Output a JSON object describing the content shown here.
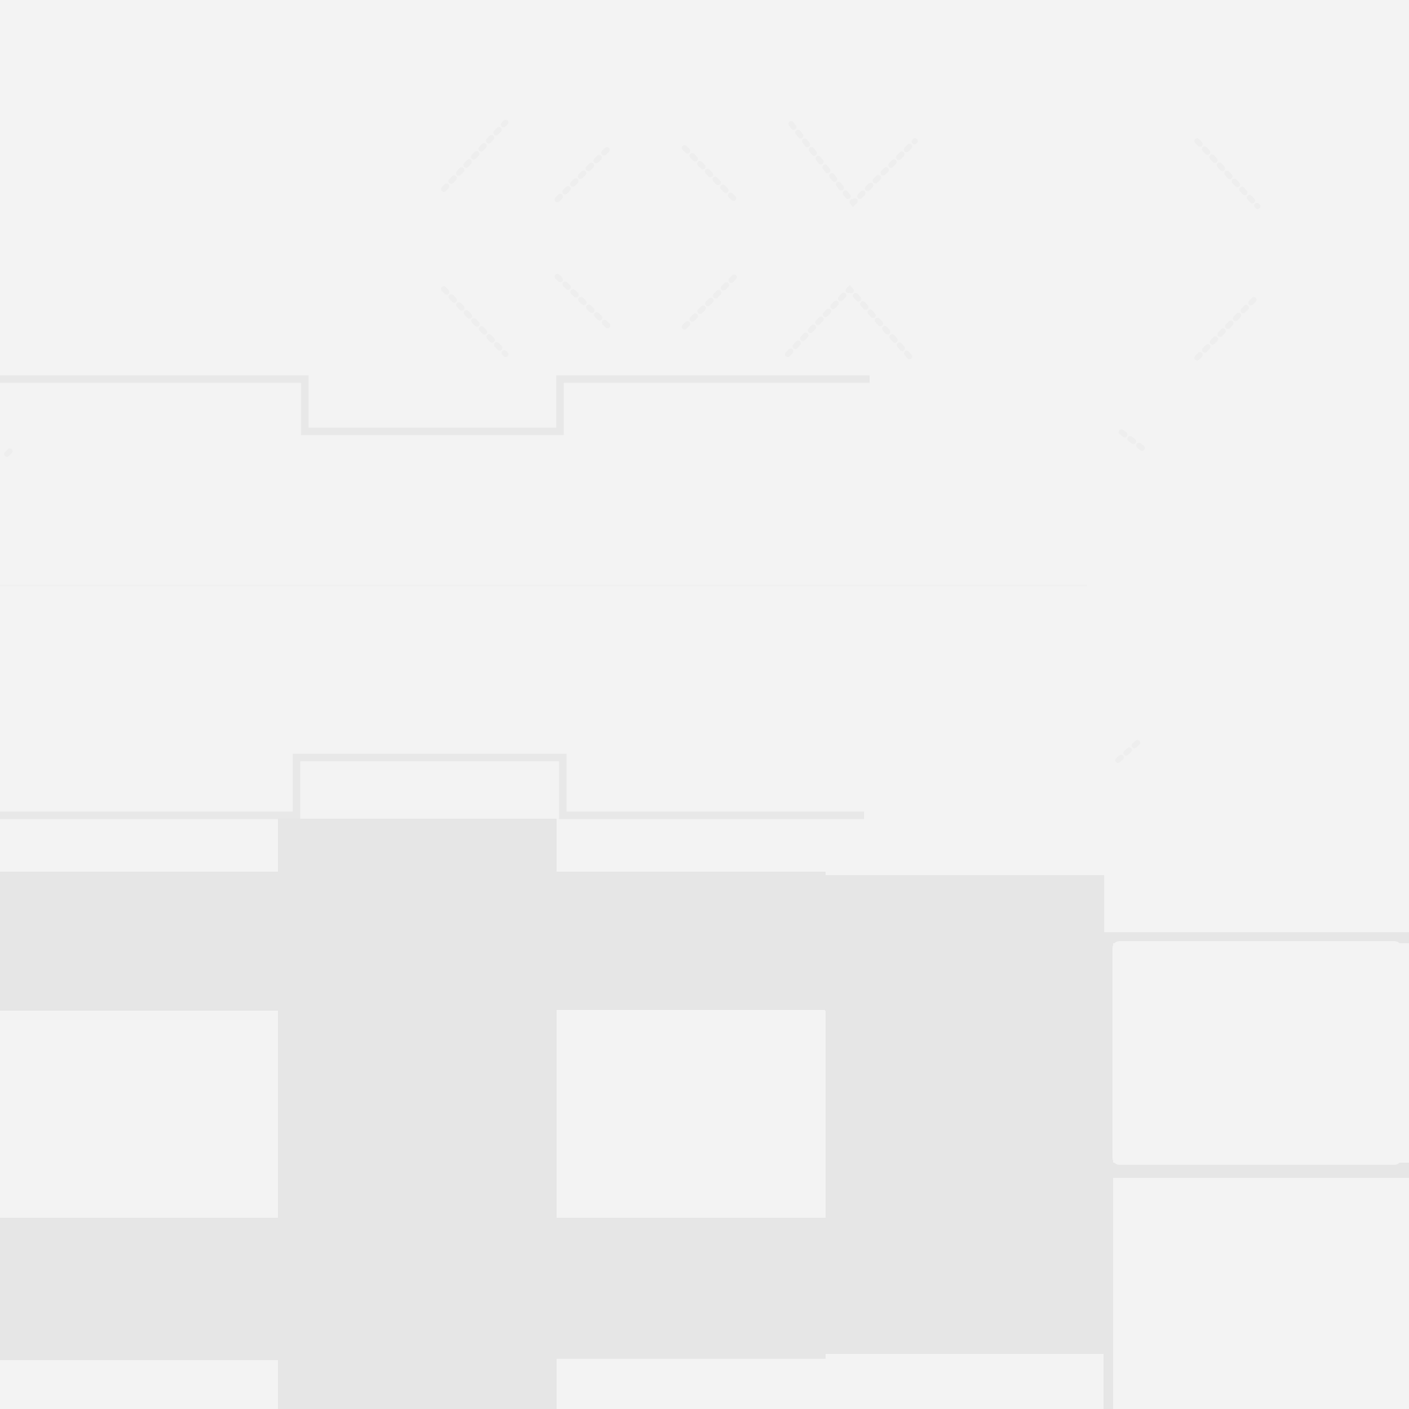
{
  "colors": {
    "background": "#f3f3f3",
    "block": "#e6e6e6",
    "outline": "#e8e8e8",
    "pattern": "#efefef"
  }
}
